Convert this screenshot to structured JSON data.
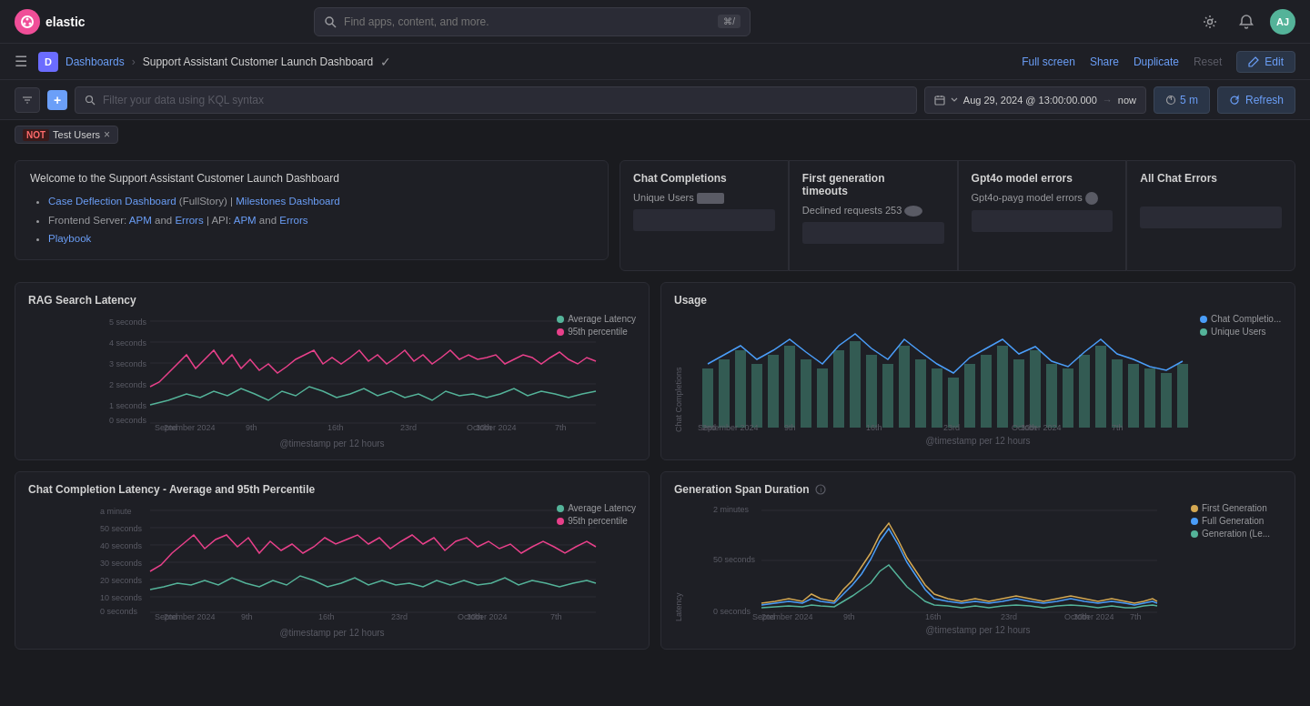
{
  "app": {
    "logo_text": "elastic",
    "search_placeholder": "Find apps, content, and more.",
    "search_shortcut": "⌘/",
    "avatar_initials": "AJ"
  },
  "breadcrumb": {
    "d_label": "D",
    "dashboards_label": "Dashboards",
    "current_label": "Support Assistant Customer Launch Dashboard"
  },
  "actions": {
    "full_screen": "Full screen",
    "share": "Share",
    "duplicate": "Duplicate",
    "reset": "Reset",
    "edit": "Edit"
  },
  "filter_bar": {
    "kql_placeholder": "Filter your data using KQL syntax",
    "date_range": "Aug 29, 2024 @ 13:00:00.000",
    "date_separator": "→",
    "date_end": "now",
    "interval": "5 m",
    "refresh": "Refresh"
  },
  "tag": {
    "not_label": "NOT",
    "value": "Test Users",
    "close": "×"
  },
  "welcome": {
    "title": "Welcome to the Support Assistant Customer Launch Dashboard",
    "links": [
      {
        "label": "Case Deflection Dashboard",
        "href": "#",
        "suffix": " (FullStory) | "
      },
      {
        "label": "Milestones Dashboard",
        "href": "#"
      }
    ],
    "line2_prefix": "Frontend Server: ",
    "apm1": "APM",
    "and1": " and ",
    "errors1": "Errors",
    "api_prefix": " | API: ",
    "apm2": "APM",
    "and2": " and ",
    "errors2": "Errors",
    "playbook": "Playbook"
  },
  "metrics": [
    {
      "title": "Chat Completions",
      "subtitle": "Unique Users",
      "value": ""
    },
    {
      "title": "First generation timeouts",
      "subtitle": "Declined requests",
      "value": "253"
    },
    {
      "title": "Gpt4o model errors",
      "subtitle": "Gpt4o-payg model errors",
      "value": ""
    },
    {
      "title": "All Chat Errors",
      "subtitle": "",
      "value": ""
    }
  ],
  "charts": {
    "rag": {
      "title": "RAG Search Latency",
      "footer": "@timestamp per 12 hours",
      "legend": [
        "Average Latency",
        "95th percentile"
      ],
      "legend_colors": [
        "#54b399",
        "#e8408a"
      ],
      "y_labels": [
        "5 seconds",
        "4 seconds",
        "3 seconds",
        "2 seconds",
        "1 seconds",
        "0 seconds"
      ],
      "x_labels": [
        "2nd\nSeptember 2024",
        "9th",
        "16th",
        "23rd",
        "30th\nOctober 2024",
        "7th"
      ]
    },
    "usage": {
      "title": "Usage",
      "footer": "@timestamp per 12 hours",
      "legend": [
        "Chat Completio...",
        "Unique Users"
      ],
      "legend_colors": [
        "#4a9df8",
        "#54b399"
      ],
      "y_label": "Chat Completions",
      "x_labels": [
        "2nd\nSeptember 2024",
        "9th",
        "16th",
        "23rd",
        "30th\nOctober 2024",
        "7th"
      ]
    },
    "completion_latency": {
      "title": "Chat Completion Latency - Average and 95th Percentile",
      "footer": "@timestamp per 12 hours",
      "legend": [
        "Average Latency",
        "95th percentile"
      ],
      "legend_colors": [
        "#54b399",
        "#e8408a"
      ],
      "y_labels": [
        "a minute",
        "50 seconds",
        "40 seconds",
        "30 seconds",
        "20 seconds",
        "10 seconds",
        "0 seconds"
      ],
      "x_labels": [
        "2nd\nSeptember 2024",
        "9th",
        "16th",
        "23rd",
        "30th\nOctober 2024",
        "7th"
      ]
    },
    "generation_span": {
      "title": "Generation Span Duration",
      "footer": "@timestamp per 12 hours",
      "legend": [
        "First Generation",
        "Full Generation",
        "Generation (Le..."
      ],
      "legend_colors": [
        "#d4a852",
        "#4a9df8",
        "#54b399"
      ],
      "y_labels": [
        "2 minutes",
        "50 seconds",
        "0 seconds"
      ],
      "x_labels": [
        "2nd\nSeptember 2024",
        "9th",
        "16th",
        "23rd",
        "30th\nOctober 2024",
        "7th"
      ]
    }
  }
}
